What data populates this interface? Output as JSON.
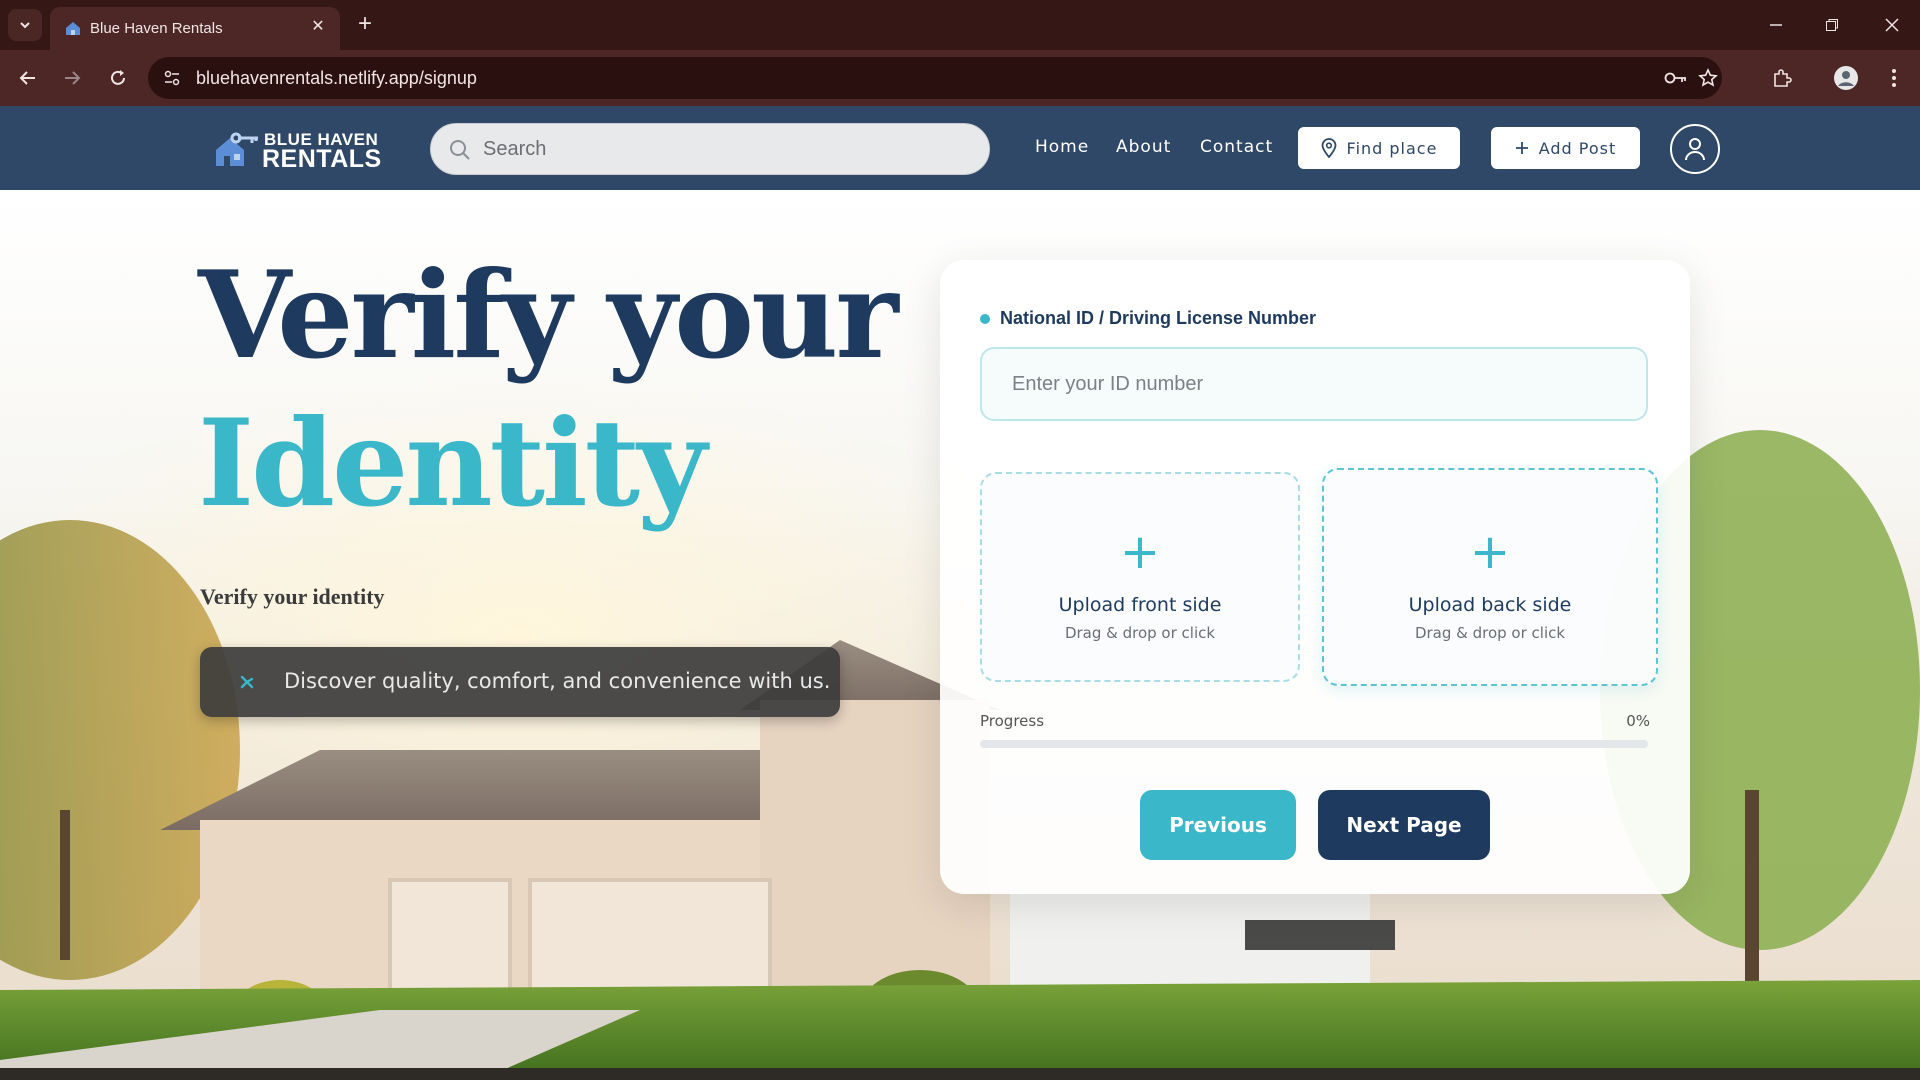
{
  "browser": {
    "tab_title": "Blue Haven Rentals",
    "url": "bluehavenrentals.netlify.app/signup"
  },
  "header": {
    "logo_line1": "BLUE HAVEN",
    "logo_line2": "RENTALS",
    "search_placeholder": "Search",
    "nav": [
      "Home",
      "About",
      "Contact"
    ],
    "find_place_label": "Find place",
    "add_post_label": "Add Post"
  },
  "hero": {
    "title_line1": "Verify your",
    "title_line2": "Identity",
    "subtitle": "Verify your identity",
    "tagline": "Discover quality, comfort, and convenience with us."
  },
  "form": {
    "id_label": "National ID / Driving License Number",
    "id_placeholder": "Enter your ID number",
    "id_value": "",
    "upload_front": {
      "plus": "+",
      "title": "Upload front side",
      "hint": "Drag & drop or click"
    },
    "upload_back": {
      "plus": "+",
      "title": "Upload back side",
      "hint": "Drag & drop or click"
    },
    "progress_label": "Progress",
    "progress_text": "0%",
    "progress_fraction": 0,
    "previous_label": "Previous",
    "next_label": "Next Page"
  },
  "colors": {
    "brand_dark": "#1e3a5f",
    "brand_teal": "#3ab7c9",
    "header_bg": "#2f4867",
    "browser_dark": "#351716"
  }
}
